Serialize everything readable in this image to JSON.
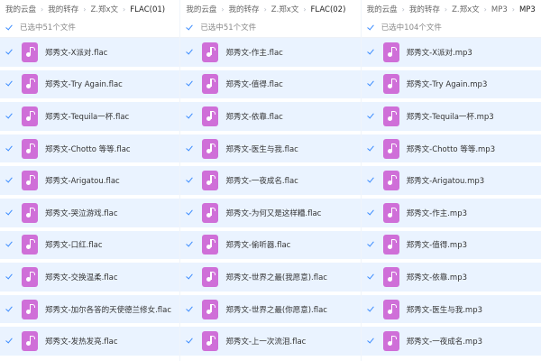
{
  "panels": [
    {
      "breadcrumb": [
        "我的云盘",
        "我的转存",
        "Z.郑x文",
        "FLAC(01)"
      ],
      "selection_text": "已选中51个文件",
      "files": [
        "郑秀文-X派对.flac",
        "郑秀文-Try Again.flac",
        "郑秀文-Tequila一杯.flac",
        "郑秀文-Chotto 等等.flac",
        "郑秀文-Arigatou.flac",
        "郑秀文-哭泣游戏.flac",
        "郑秀文-口红.flac",
        "郑秀文-交换温柔.flac",
        "郑秀文-加尔各答的天使德兰修女.flac",
        "郑秀文-发热发亮.flac"
      ]
    },
    {
      "breadcrumb": [
        "我的云盘",
        "我的转存",
        "Z.郑x文",
        "FLAC(02)"
      ],
      "selection_text": "已选中51个文件",
      "files": [
        "郑秀文-作主.flac",
        "郑秀文-值得.flac",
        "郑秀文-依靠.flac",
        "郑秀文-医生与我.flac",
        "郑秀文-一夜成名.flac",
        "郑秀文-为何又是这样糟.flac",
        "郑秀文-偷听器.flac",
        "郑秀文-世界之最(我愿意).flac",
        "郑秀文-世界之最(你愿意).flac",
        "郑秀文-上一次流泪.flac"
      ]
    },
    {
      "breadcrumb": [
        "我的云盘",
        "我的转存",
        "Z.郑x文",
        "MP3",
        "MP3"
      ],
      "selection_text": "已选中104个文件",
      "files": [
        "郑秀文-X派对.mp3",
        "郑秀文-Try Again.mp3",
        "郑秀文-Tequila一杯.mp3",
        "郑秀文-Chotto 等等.mp3",
        "郑秀文-Arigatou.mp3",
        "郑秀文-作主.mp3",
        "郑秀文-值得.mp3",
        "郑秀文-依靠.mp3",
        "郑秀文-医生与我.mp3",
        "郑秀文-一夜成名.mp3"
      ]
    }
  ],
  "colors": {
    "accent": "#3b8cff",
    "row_selected_bg": "#eaf3ff",
    "audio_icon": "#cf6fd8"
  },
  "icons": {
    "checkbox": "checkmark-icon",
    "file": "music-file-icon",
    "separator": "chevron-right-icon"
  }
}
